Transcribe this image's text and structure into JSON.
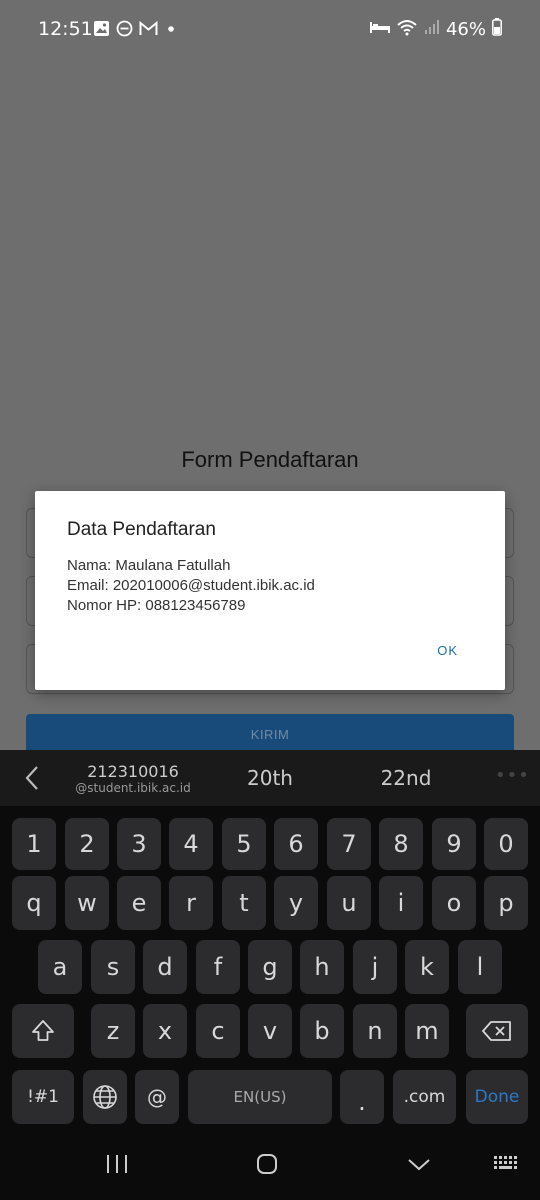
{
  "status_bar": {
    "time": "12:51",
    "left_icons": [
      "image-icon",
      "do-not-disturb-icon",
      "gmail-icon",
      "dot-icon"
    ],
    "right_icons": [
      "sleep-mode-icon",
      "wifi-icon",
      "signal-icon",
      "battery-icon"
    ],
    "battery_percent": "46%"
  },
  "form": {
    "title": "Form Pendaftaran",
    "submit_label": "KIRIM"
  },
  "dialog": {
    "title": "Data Pendaftaran",
    "lines": [
      "Nama: Maulana Fatullah",
      "Email: 202010006@student.ibik.ac.id",
      "Nomor HP: 088123456789"
    ],
    "ok_label": "OK"
  },
  "keyboard": {
    "suggestions": {
      "first_main": "212310016",
      "first_sub": "@student.ibik.ac.id",
      "second": "20th",
      "third": "22nd",
      "more": "•••"
    },
    "row_numbers": [
      "1",
      "2",
      "3",
      "4",
      "5",
      "6",
      "7",
      "8",
      "9",
      "0"
    ],
    "row_top": [
      "q",
      "w",
      "e",
      "r",
      "t",
      "y",
      "u",
      "i",
      "o",
      "p"
    ],
    "row_mid": [
      "a",
      "s",
      "d",
      "f",
      "g",
      "h",
      "j",
      "k",
      "l"
    ],
    "row_bottom": [
      "z",
      "x",
      "c",
      "v",
      "b",
      "n",
      "m"
    ],
    "symbols_label": "!#1",
    "at_label": "@",
    "space_label": "EN(US)",
    "period_label": ".",
    "dotcom_label": ".com",
    "done_label": "Done",
    "accent_color": "#2b78c8"
  },
  "nav_bar": {
    "items": [
      "recent-apps-icon",
      "home-icon",
      "back-icon",
      "keyboard-switch-icon"
    ]
  }
}
